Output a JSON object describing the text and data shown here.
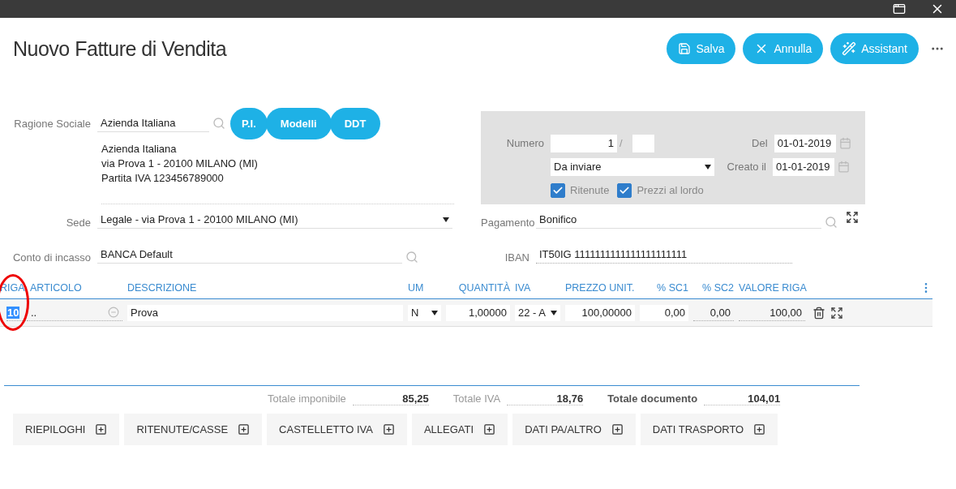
{
  "title": "Nuovo Fatture di Vendita",
  "actions": [
    {
      "label": "Salva",
      "kind": "save"
    },
    {
      "label": "Annulla",
      "kind": "cancel"
    },
    {
      "label": "Assistant",
      "kind": "wizard"
    }
  ],
  "customer": {
    "label": "Ragione Sociale",
    "value": "Azienda Italiana",
    "buttons": [
      "P.I.",
      "Modelli",
      "DDT"
    ],
    "address_lines": [
      "Azienda Italiana",
      "via Prova 1 - 20100 MILANO (MI)",
      "Partita IVA 123456789000"
    ]
  },
  "sede": {
    "label": "Sede",
    "value": "Legale - via Prova 1 - 20100 MILANO (MI)"
  },
  "conto": {
    "label": "Conto di incasso",
    "value": "BANCA Default"
  },
  "document": {
    "numero_label": "Numero",
    "numero": "1",
    "separator": "/",
    "status": "Da inviare",
    "del_label": "Del",
    "del": "01-01-2019",
    "created_label": "Creato il",
    "created": "01-01-2019",
    "checkboxes": [
      {
        "label": "Ritenute",
        "checked": true
      },
      {
        "label": "Prezzi al lordo",
        "checked": true
      }
    ]
  },
  "pagamento": {
    "label": "Pagamento",
    "value": "Bonifico"
  },
  "iban": {
    "label": "IBAN",
    "value": "IT50IG 1111111111111111111111"
  },
  "table": {
    "columns": [
      "RIGA",
      "ARTICOLO",
      "DESCRIZIONE",
      "UM",
      "QUANTITÀ",
      "IVA",
      "PREZZO UNIT.",
      "% SC1",
      "% SC2",
      "VALORE RIGA"
    ],
    "rows": [
      {
        "riga": "10",
        "articolo": "..",
        "descrizione": "Prova",
        "um": "N",
        "quantita": "1,00000",
        "iva": "22 - A",
        "prezzo": "100,00000",
        "sc1": "0,00",
        "sc2": "0,00",
        "valore": "100,00"
      }
    ]
  },
  "totals": [
    {
      "label": "Totale imponibile",
      "value": "85,25",
      "kind": "normal"
    },
    {
      "label": "Totale IVA",
      "value": "18,76",
      "kind": "normal"
    },
    {
      "label": "Totale documento",
      "value": "104,01",
      "kind": "grand"
    }
  ],
  "sections": [
    "RIEPILOGHI",
    "RITENUTE/CASSE",
    "CASTELLETTO IVA",
    "ALLEGATI",
    "DATI PA/ALTRO",
    "DATI TRASPORTO"
  ]
}
